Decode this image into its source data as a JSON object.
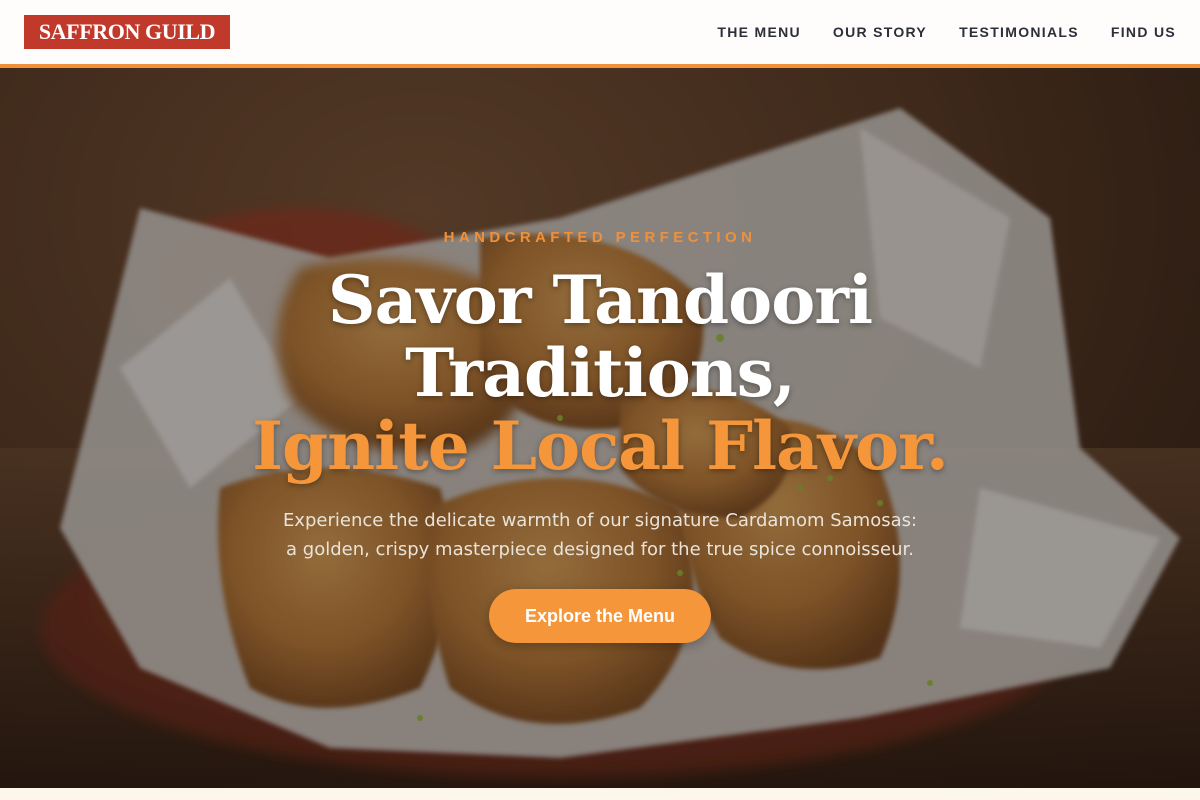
{
  "header": {
    "logo_text": "SAFFRON GUILD",
    "nav": {
      "menu": "THE MENU",
      "story": "OUR STORY",
      "testimonials": "TESTIMONIALS",
      "find_us": "FIND US"
    }
  },
  "hero": {
    "eyebrow": "HANDCRAFTED PERFECTION",
    "headline_line1": "Savor Tandoori",
    "headline_line2": "Traditions,",
    "headline_accent": "Ignite Local Flavor.",
    "subtext": "Experience the delicate warmth of our signature Cardamom Samosas: a golden, crispy masterpiece designed for the true spice connoisseur.",
    "cta_label": "Explore the Menu",
    "background_image": "samosas-in-paper-lined-bowl"
  },
  "colors": {
    "brand_red": "#c0392b",
    "accent_orange": "#f5963a",
    "nav_text": "#2c2f3a",
    "header_border": "#f0913a"
  }
}
